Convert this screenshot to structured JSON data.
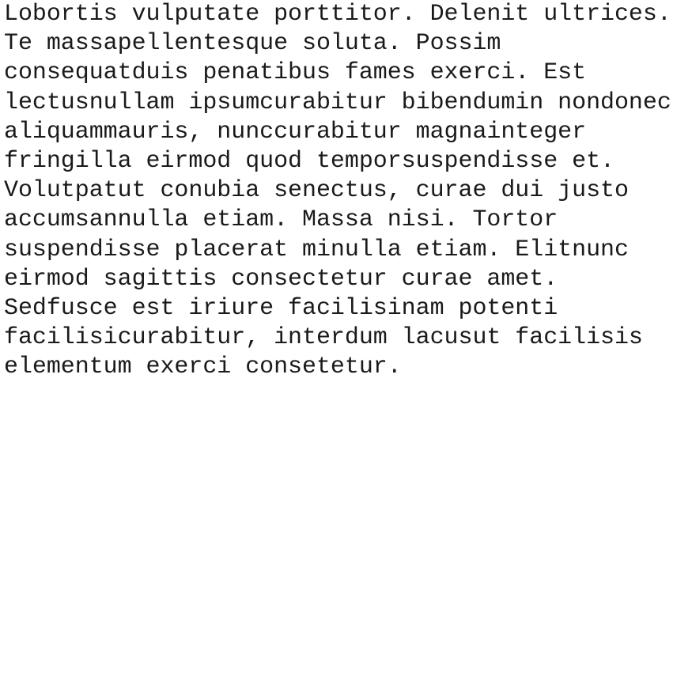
{
  "document": {
    "lines": [
      "Lobortis vulputate porttitor. Delenit ultrices.",
      "Te massapellentesque soluta. Possim",
      "consequatduis penatibus fames exerci. Est",
      "lectusnullam ipsumcurabitur bibendumin nondonec",
      "aliquammauris, nunccurabitur magnainteger",
      "fringilla eirmod quod temporsuspendisse et.",
      "Volutpatut conubia senectus, curae dui justo",
      "accumsannulla etiam. Massa nisi. Tortor",
      "suspendisse placerat minulla etiam. Elitnunc",
      "eirmod sagittis consectetur curae amet.",
      "Sedfusce est iriure facilisinam potenti",
      "facilisicurabitur, interdum lacusut facilisis",
      "elementum exerci consetetur."
    ]
  }
}
